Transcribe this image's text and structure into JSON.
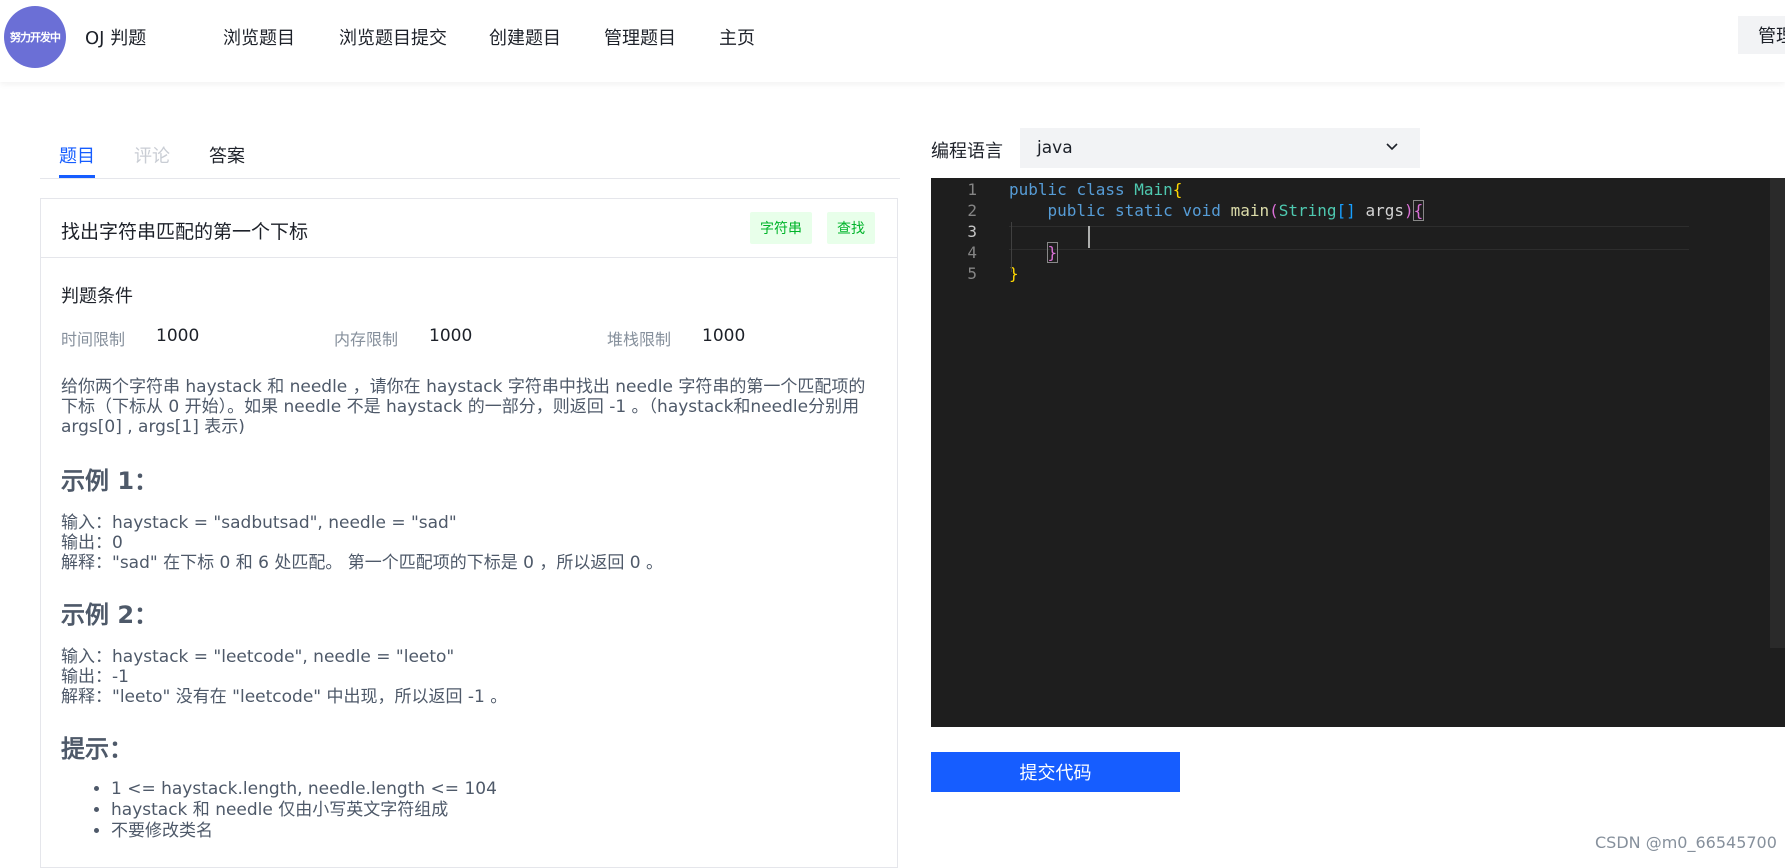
{
  "header": {
    "logo_text": "努力开发中",
    "app_title": "OJ 判题",
    "nav": [
      "浏览题目",
      "浏览题目提交",
      "创建题目",
      "管理题目",
      "主页"
    ],
    "admin_label": "管理"
  },
  "left": {
    "tabs": [
      "题目",
      "评论",
      "答案"
    ],
    "question": {
      "title": "找出字符串匹配的第一个下标",
      "tags": [
        "字符串",
        "查找"
      ],
      "judge_title": "判题条件",
      "limits": [
        {
          "label": "时间限制",
          "value": "1000"
        },
        {
          "label": "内存限制",
          "value": "1000"
        },
        {
          "label": "堆栈限制",
          "value": "1000"
        }
      ],
      "description": [
        "给你两个字符串 haystack 和 needle ，请你在 haystack 字符串中找出 needle 字符串的第一个匹配项的",
        "下标（下标从 0 开始）。如果 needle 不是 haystack 的一部分，则返回 -1 。（haystack和needle分别用",
        "args[0] , args[1] 表示)"
      ],
      "example1": {
        "title": "示例 1：",
        "lines": [
          "输入：haystack = \"sadbutsad\", needle = \"sad\"",
          "输出：0",
          "解释：\"sad\" 在下标 0 和 6 处匹配。 第一个匹配项的下标是 0 ，所以返回 0 。"
        ]
      },
      "example2": {
        "title": "示例 2：",
        "lines": [
          "输入：haystack = \"leetcode\", needle = \"leeto\"",
          "输出：-1",
          "解释：\"leeto\" 没有在 \"leetcode\" 中出现，所以返回 -1 。"
        ]
      },
      "hints": {
        "title": "提示：",
        "items": [
          "1 <= haystack.length, needle.length <= 104",
          "haystack 和 needle 仅由小写英文字符组成",
          "不要修改类名"
        ]
      }
    }
  },
  "right": {
    "lang_label": "编程语言",
    "lang_value": "java",
    "line_numbers": [
      "1",
      "2",
      "3",
      "4",
      "5"
    ],
    "submit_label": "提交代码"
  },
  "watermark": "CSDN @m0_66545700",
  "colors": {
    "primary": "#165dff",
    "tag_bg": "#e8ffea",
    "tag_text": "#00b42a",
    "editor_bg": "#1e1e1e",
    "logo_bg": "#6b6fd6"
  }
}
